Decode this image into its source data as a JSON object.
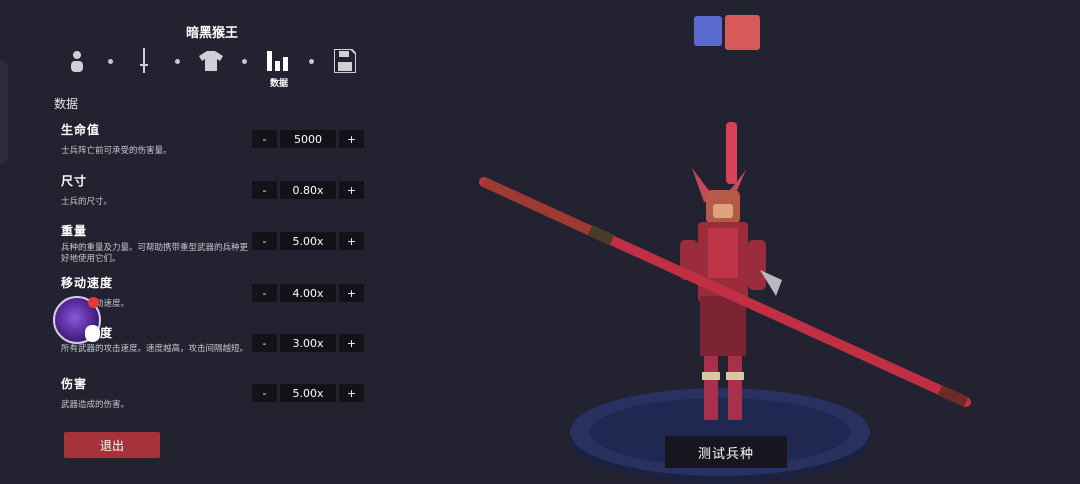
{
  "header": {
    "unit_title": "暗黑猴王"
  },
  "steps": [
    {
      "name": "body",
      "icon": "person-icon",
      "active": false
    },
    {
      "name": "weapon",
      "icon": "sword-icon",
      "active": false
    },
    {
      "name": "clothing",
      "icon": "shirt-icon",
      "active": false
    },
    {
      "name": "stats",
      "icon": "bar-chart-icon",
      "active": true,
      "label": "数据"
    },
    {
      "name": "save",
      "icon": "save-icon",
      "active": false
    }
  ],
  "section_title": "数据",
  "stats": [
    {
      "name": "生命值",
      "desc": "士兵阵亡前可承受的伤害量。",
      "value": "5000"
    },
    {
      "name": "尺寸",
      "desc": "士兵的尺寸。",
      "value": "0.80x"
    },
    {
      "name": "重量",
      "desc": "兵种的重量及力量。可帮助携带重型武器的兵种更好地使用它们。",
      "value": "5.00x"
    },
    {
      "name": "移动速度",
      "desc": "士兵的移动速度。",
      "value": "4.00x"
    },
    {
      "name": "攻击速度",
      "desc": "所有武器的攻击速度。速度越高，攻击间隔越短。",
      "value": "3.00x"
    },
    {
      "name": "伤害",
      "desc": "武器造成的伤害。",
      "value": "5.00x"
    }
  ],
  "stepper": {
    "minus": "-",
    "plus": "+"
  },
  "exit_label": "退出",
  "test_label": "测试兵种",
  "colors": {
    "team_blue": "#5b6bd0",
    "team_red": "#d65a58",
    "accent_red": "#a6333a"
  }
}
